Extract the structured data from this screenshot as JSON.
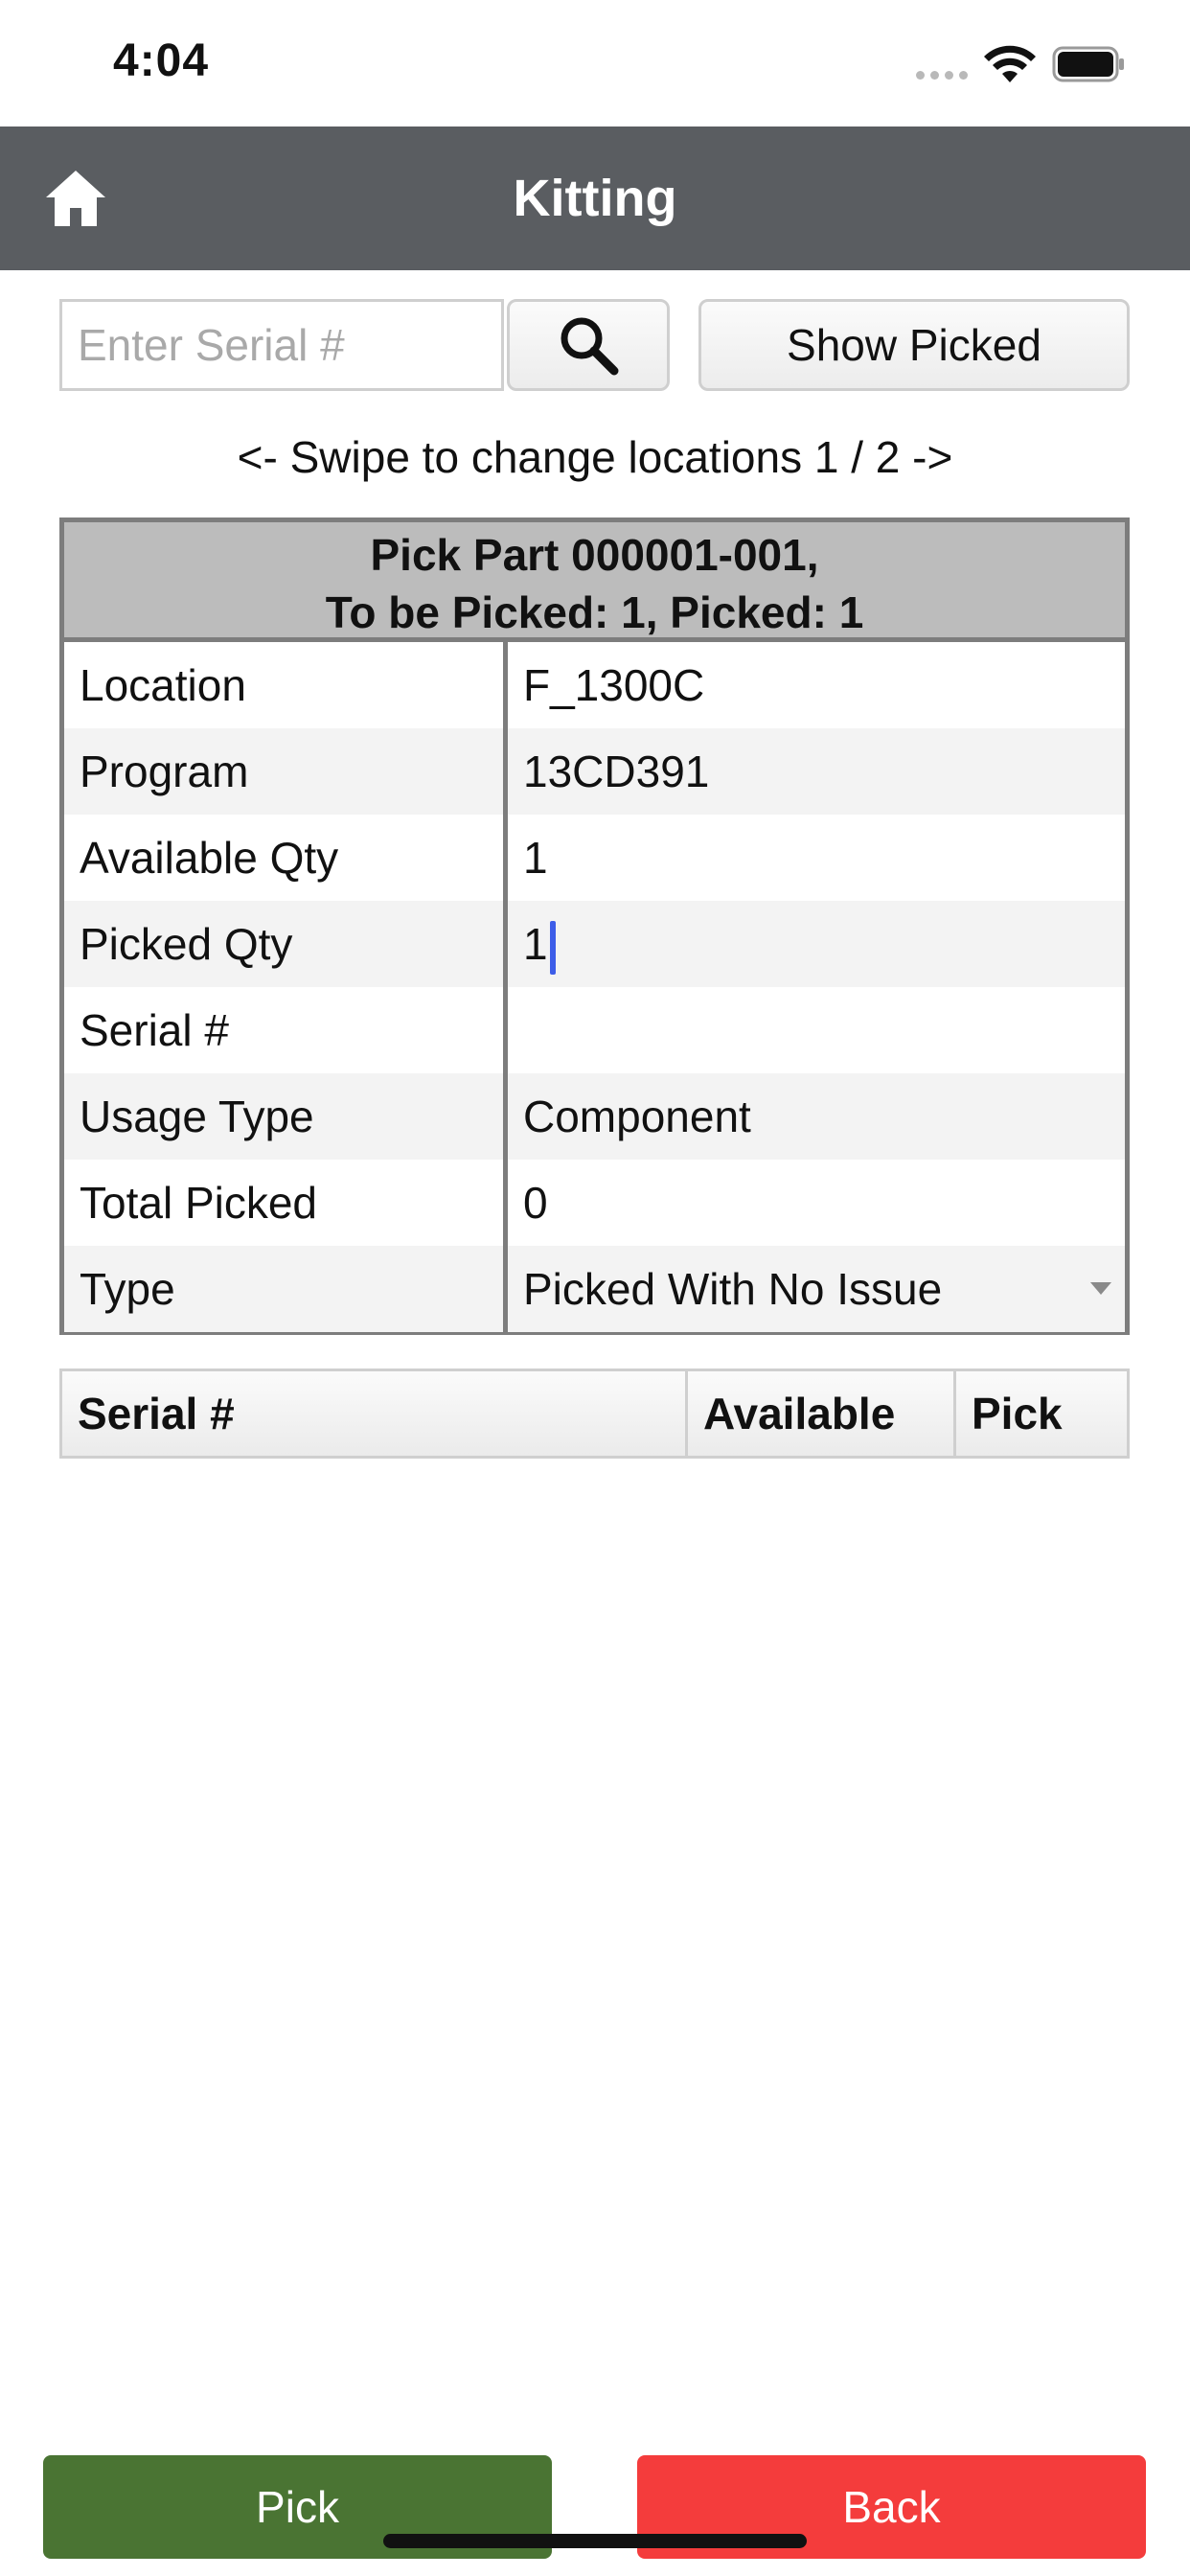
{
  "status_bar": {
    "time": "4:04"
  },
  "header": {
    "title": "Kitting",
    "home_icon": "home-icon"
  },
  "search": {
    "placeholder": "Enter Serial #",
    "value": "",
    "search_icon": "search-icon",
    "show_picked_label": "Show Picked"
  },
  "swipe_hint": "<- Swipe to change locations 1 / 2 ->",
  "pick_detail": {
    "header_line1": "Pick Part 000001-001,",
    "header_line2": "To be Picked: 1, Picked: 1",
    "rows": [
      {
        "label": "Location",
        "value": "F_1300C"
      },
      {
        "label": "Program",
        "value": "13CD391"
      },
      {
        "label": "Available Qty",
        "value": "1"
      },
      {
        "label": "Picked Qty",
        "value": "1"
      },
      {
        "label": "Serial #",
        "value": ""
      },
      {
        "label": "Usage Type",
        "value": "Component"
      },
      {
        "label": "Total Picked",
        "value": "0"
      },
      {
        "label": "Type",
        "value": "Picked With No Issue"
      }
    ]
  },
  "serial_list": {
    "columns": [
      "Serial #",
      "Available",
      "Pick"
    ]
  },
  "actions": {
    "pick_label": "Pick",
    "back_label": "Back"
  },
  "colors": {
    "header_bg": "#5a5d61",
    "pick_button": "#4a7433",
    "back_button": "#f43c3c",
    "cursor": "#3d5de8"
  }
}
